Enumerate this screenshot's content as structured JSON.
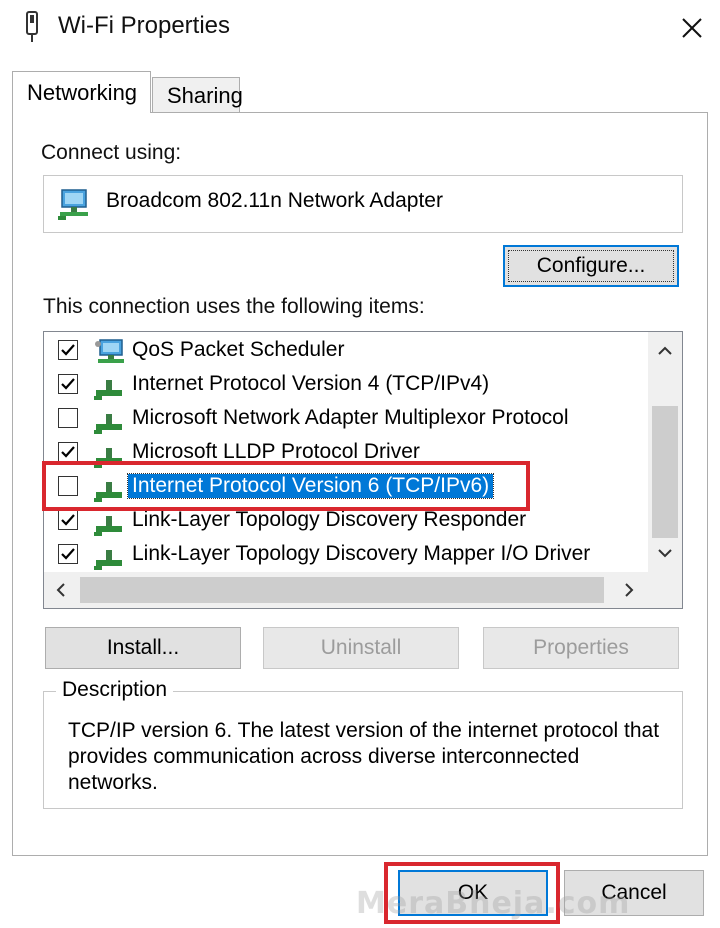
{
  "window": {
    "title": "Wi-Fi Properties",
    "close_glyph": "✕"
  },
  "tabs": [
    {
      "label": "Networking",
      "active": true
    },
    {
      "label": "Sharing",
      "active": false
    }
  ],
  "connect_using": {
    "label": "Connect using:",
    "adapter_name": "Broadcom 802.11n Network Adapter",
    "adapter_icon": "network-adapter-icon"
  },
  "configure_label": "Configure...",
  "items_label": "This connection uses the following items:",
  "items": [
    {
      "label": "QoS Packet Scheduler",
      "checked": true,
      "icon": "qos-scheduler-icon",
      "selected": false
    },
    {
      "label": "Internet Protocol Version 4 (TCP/IPv4)",
      "checked": true,
      "icon": "protocol-icon",
      "selected": false
    },
    {
      "label": "Microsoft Network Adapter Multiplexor Protocol",
      "checked": false,
      "icon": "protocol-icon",
      "selected": false
    },
    {
      "label": "Microsoft LLDP Protocol Driver",
      "checked": true,
      "icon": "protocol-icon",
      "selected": false
    },
    {
      "label": "Internet Protocol Version 6 (TCP/IPv6)",
      "checked": false,
      "icon": "protocol-icon",
      "selected": true
    },
    {
      "label": "Link-Layer Topology Discovery Responder",
      "checked": true,
      "icon": "protocol-icon",
      "selected": false
    },
    {
      "label": "Link-Layer Topology Discovery Mapper I/O Driver",
      "checked": true,
      "icon": "protocol-icon",
      "selected": false
    }
  ],
  "buttons": {
    "install": "Install...",
    "uninstall": "Uninstall",
    "properties": "Properties",
    "ok": "OK",
    "cancel": "Cancel"
  },
  "description": {
    "legend": "Description",
    "text": "TCP/IP version 6. The latest version of the internet protocol that provides communication across diverse interconnected networks."
  },
  "watermark": "MeraBheja.com",
  "colors": {
    "accent": "#0078d7",
    "highlight": "#d9272e",
    "protocol_green": "#2e8b3a"
  }
}
